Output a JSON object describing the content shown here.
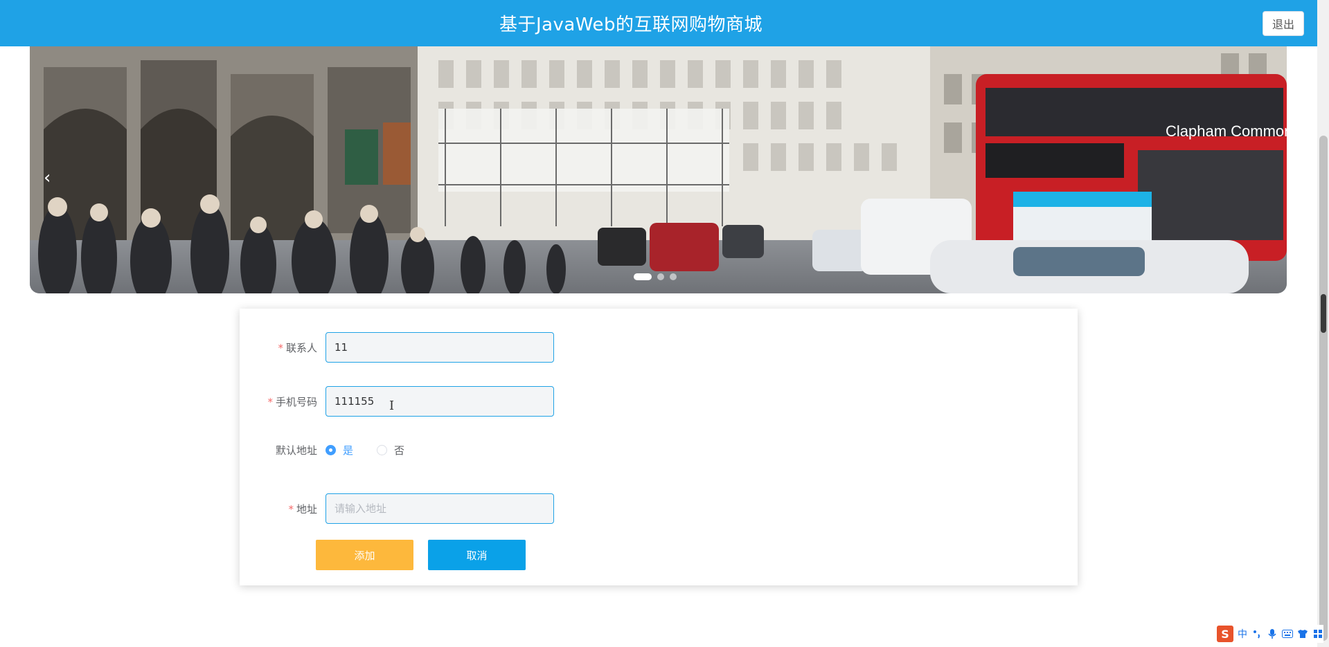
{
  "header": {
    "title": "基于JavaWeb的互联网购物商城",
    "logout_label": "退出"
  },
  "banner": {
    "prev_icon": "chevron-left-icon",
    "prev_glyph": "‹",
    "dots": 3,
    "active_dot": 1,
    "image_description": "London street scene with red double-decker bus and cars"
  },
  "form": {
    "contact": {
      "label": "联系人",
      "value": "11",
      "required": true
    },
    "phone": {
      "label": "手机号码",
      "value": "111155",
      "required": true
    },
    "default_address": {
      "label": "默认地址",
      "options": [
        "是",
        "否"
      ],
      "selected": "是"
    },
    "address": {
      "label": "地址",
      "value": "",
      "placeholder": "请输入地址",
      "required": true
    },
    "add_label": "添加",
    "cancel_label": "取消",
    "required_mark": "*"
  },
  "ime": {
    "logo": "S",
    "lang": "中",
    "icons": [
      "punctuation-icon",
      "microphone-icon",
      "keyboard-icon",
      "skin-icon",
      "grid-icon"
    ]
  },
  "colors": {
    "header_bg": "#1fa2e6",
    "add_button": "#fdb83c",
    "cancel_button": "#0aa1e8",
    "required": "#f56c6c",
    "radio_active": "#409eff"
  }
}
